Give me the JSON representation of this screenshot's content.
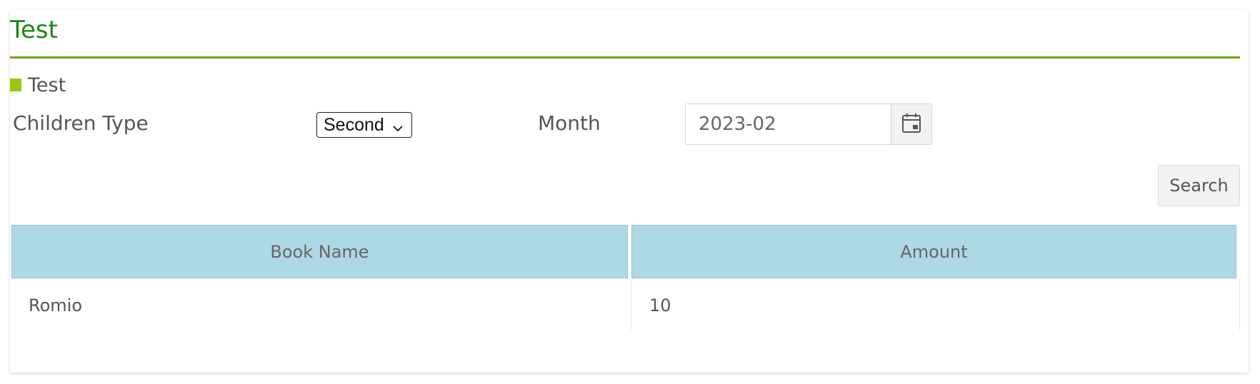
{
  "header": {
    "title": "Test"
  },
  "section": {
    "title": "Test"
  },
  "filters": {
    "children_type_label": "Children Type",
    "children_type_value": "Second",
    "month_label": "Month",
    "month_value": "2023-02"
  },
  "actions": {
    "search_label": "Search"
  },
  "table": {
    "columns": [
      "Book Name",
      "Amount"
    ],
    "rows": [
      [
        "Romio",
        "10"
      ]
    ]
  },
  "colors": {
    "title": "#1a8a10",
    "rule": "#6fa60a",
    "section_square": "#97c80f",
    "table_header": "#add8e6"
  },
  "icons": {
    "calendar": "calendar-icon",
    "dropdown": "chevron-down-icon"
  }
}
